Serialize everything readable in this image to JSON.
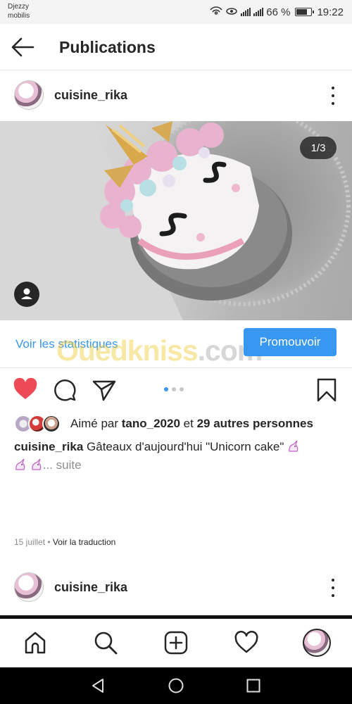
{
  "status_bar": {
    "carrier_line1": "Djezzy",
    "carrier_line2": "mobilis",
    "battery": "66 %",
    "time": "19:22"
  },
  "header": {
    "title": "Publications"
  },
  "post": {
    "username": "cuisine_rika",
    "image_counter": "1/3",
    "stats_link": "Voir les statistiques",
    "promote_label": "Promouvoir",
    "watermark": "Ouedkniss",
    "watermark_suffix": ".com",
    "likes_prefix": "Aimé par",
    "likes_user": "tano_2020",
    "likes_middle": "et",
    "likes_count": "29 autres personnes",
    "caption_text": "Gâteaux d'aujourd'hui \"Unicorn cake\"",
    "caption_more": "... suite",
    "date": "15 juillet",
    "meta_separator": " • ",
    "translate_link": "Voir la traduction"
  },
  "next_post": {
    "username": "cuisine_rika"
  },
  "icons": {
    "back": "arrow-left-icon",
    "more": "more-vertical-icon",
    "like": "heart-filled-icon",
    "comment": "comment-icon",
    "share": "send-icon",
    "save": "bookmark-icon",
    "home": "home-icon",
    "search": "search-icon",
    "add": "add-post-icon",
    "activity": "heart-outline-icon"
  },
  "colors": {
    "accent": "#3897f0",
    "like": "#ed4956",
    "text": "#262626",
    "muted": "#8e8e8e"
  }
}
